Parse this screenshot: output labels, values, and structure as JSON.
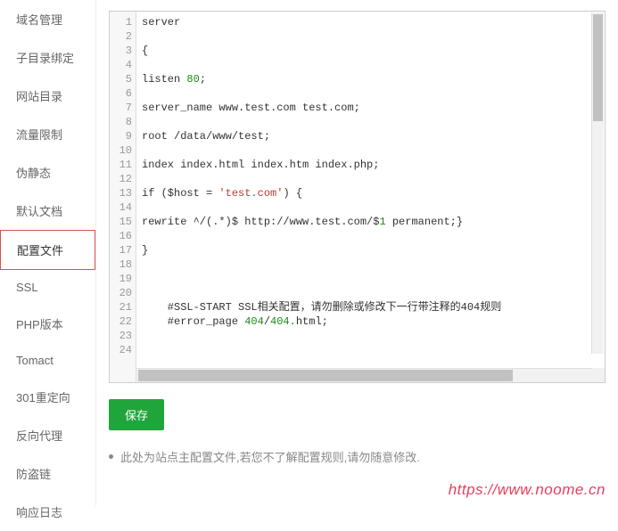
{
  "sidebar": {
    "items": [
      {
        "label": "域名管理",
        "active": false
      },
      {
        "label": "子目录绑定",
        "active": false
      },
      {
        "label": "网站目录",
        "active": false
      },
      {
        "label": "流量限制",
        "active": false
      },
      {
        "label": "伪静态",
        "active": false
      },
      {
        "label": "默认文档",
        "active": false
      },
      {
        "label": "配置文件",
        "active": true
      },
      {
        "label": "SSL",
        "active": false
      },
      {
        "label": "PHP版本",
        "active": false
      },
      {
        "label": "Tomact",
        "active": false
      },
      {
        "label": "301重定向",
        "active": false
      },
      {
        "label": "反向代理",
        "active": false
      },
      {
        "label": "防盗链",
        "active": false
      },
      {
        "label": "响应日志",
        "active": false
      }
    ]
  },
  "editor": {
    "lines": [
      {
        "n": 1,
        "segs": [
          {
            "t": "server",
            "c": ""
          }
        ]
      },
      {
        "n": 2,
        "segs": []
      },
      {
        "n": 3,
        "segs": [
          {
            "t": "{",
            "c": ""
          }
        ]
      },
      {
        "n": 4,
        "segs": []
      },
      {
        "n": 5,
        "segs": [
          {
            "t": "listen ",
            "c": ""
          },
          {
            "t": "80",
            "c": "num"
          },
          {
            "t": ";",
            "c": ""
          }
        ]
      },
      {
        "n": 6,
        "segs": []
      },
      {
        "n": 7,
        "segs": [
          {
            "t": "server_name www.test.com test.com;",
            "c": ""
          }
        ]
      },
      {
        "n": 8,
        "segs": []
      },
      {
        "n": 9,
        "segs": [
          {
            "t": "root /data/www/test;",
            "c": ""
          }
        ]
      },
      {
        "n": 10,
        "segs": []
      },
      {
        "n": 11,
        "segs": [
          {
            "t": "index index.html index.htm index.php;",
            "c": ""
          }
        ]
      },
      {
        "n": 12,
        "segs": []
      },
      {
        "n": 13,
        "segs": [
          {
            "t": "if ($host = ",
            "c": ""
          },
          {
            "t": "'test.com'",
            "c": "str"
          },
          {
            "t": ") {",
            "c": ""
          }
        ]
      },
      {
        "n": 14,
        "segs": []
      },
      {
        "n": 15,
        "segs": [
          {
            "t": "rewrite ^/(.*)$ http://www.test.com/$",
            "c": ""
          },
          {
            "t": "1",
            "c": "num"
          },
          {
            "t": " permanent;}",
            "c": ""
          }
        ]
      },
      {
        "n": 16,
        "segs": []
      },
      {
        "n": 17,
        "segs": [
          {
            "t": "}",
            "c": ""
          }
        ]
      },
      {
        "n": 18,
        "segs": []
      },
      {
        "n": 19,
        "segs": []
      },
      {
        "n": 20,
        "segs": []
      },
      {
        "n": 21,
        "segs": [
          {
            "t": "    #SSL-START SSL相关配置，请勿删除或修改下一行带注释的404规则",
            "c": ""
          }
        ]
      },
      {
        "n": 22,
        "segs": [
          {
            "t": "    #error_page ",
            "c": ""
          },
          {
            "t": "404",
            "c": "num"
          },
          {
            "t": "/",
            "c": ""
          },
          {
            "t": "404.",
            "c": "num"
          },
          {
            "t": "html;",
            "c": ""
          }
        ]
      },
      {
        "n": 23,
        "segs": []
      },
      {
        "n": 24,
        "segs": []
      }
    ]
  },
  "buttons": {
    "save": "保存"
  },
  "note": "此处为站点主配置文件,若您不了解配置规则,请勿随意修改.",
  "watermark": "https://www.noome.cn"
}
